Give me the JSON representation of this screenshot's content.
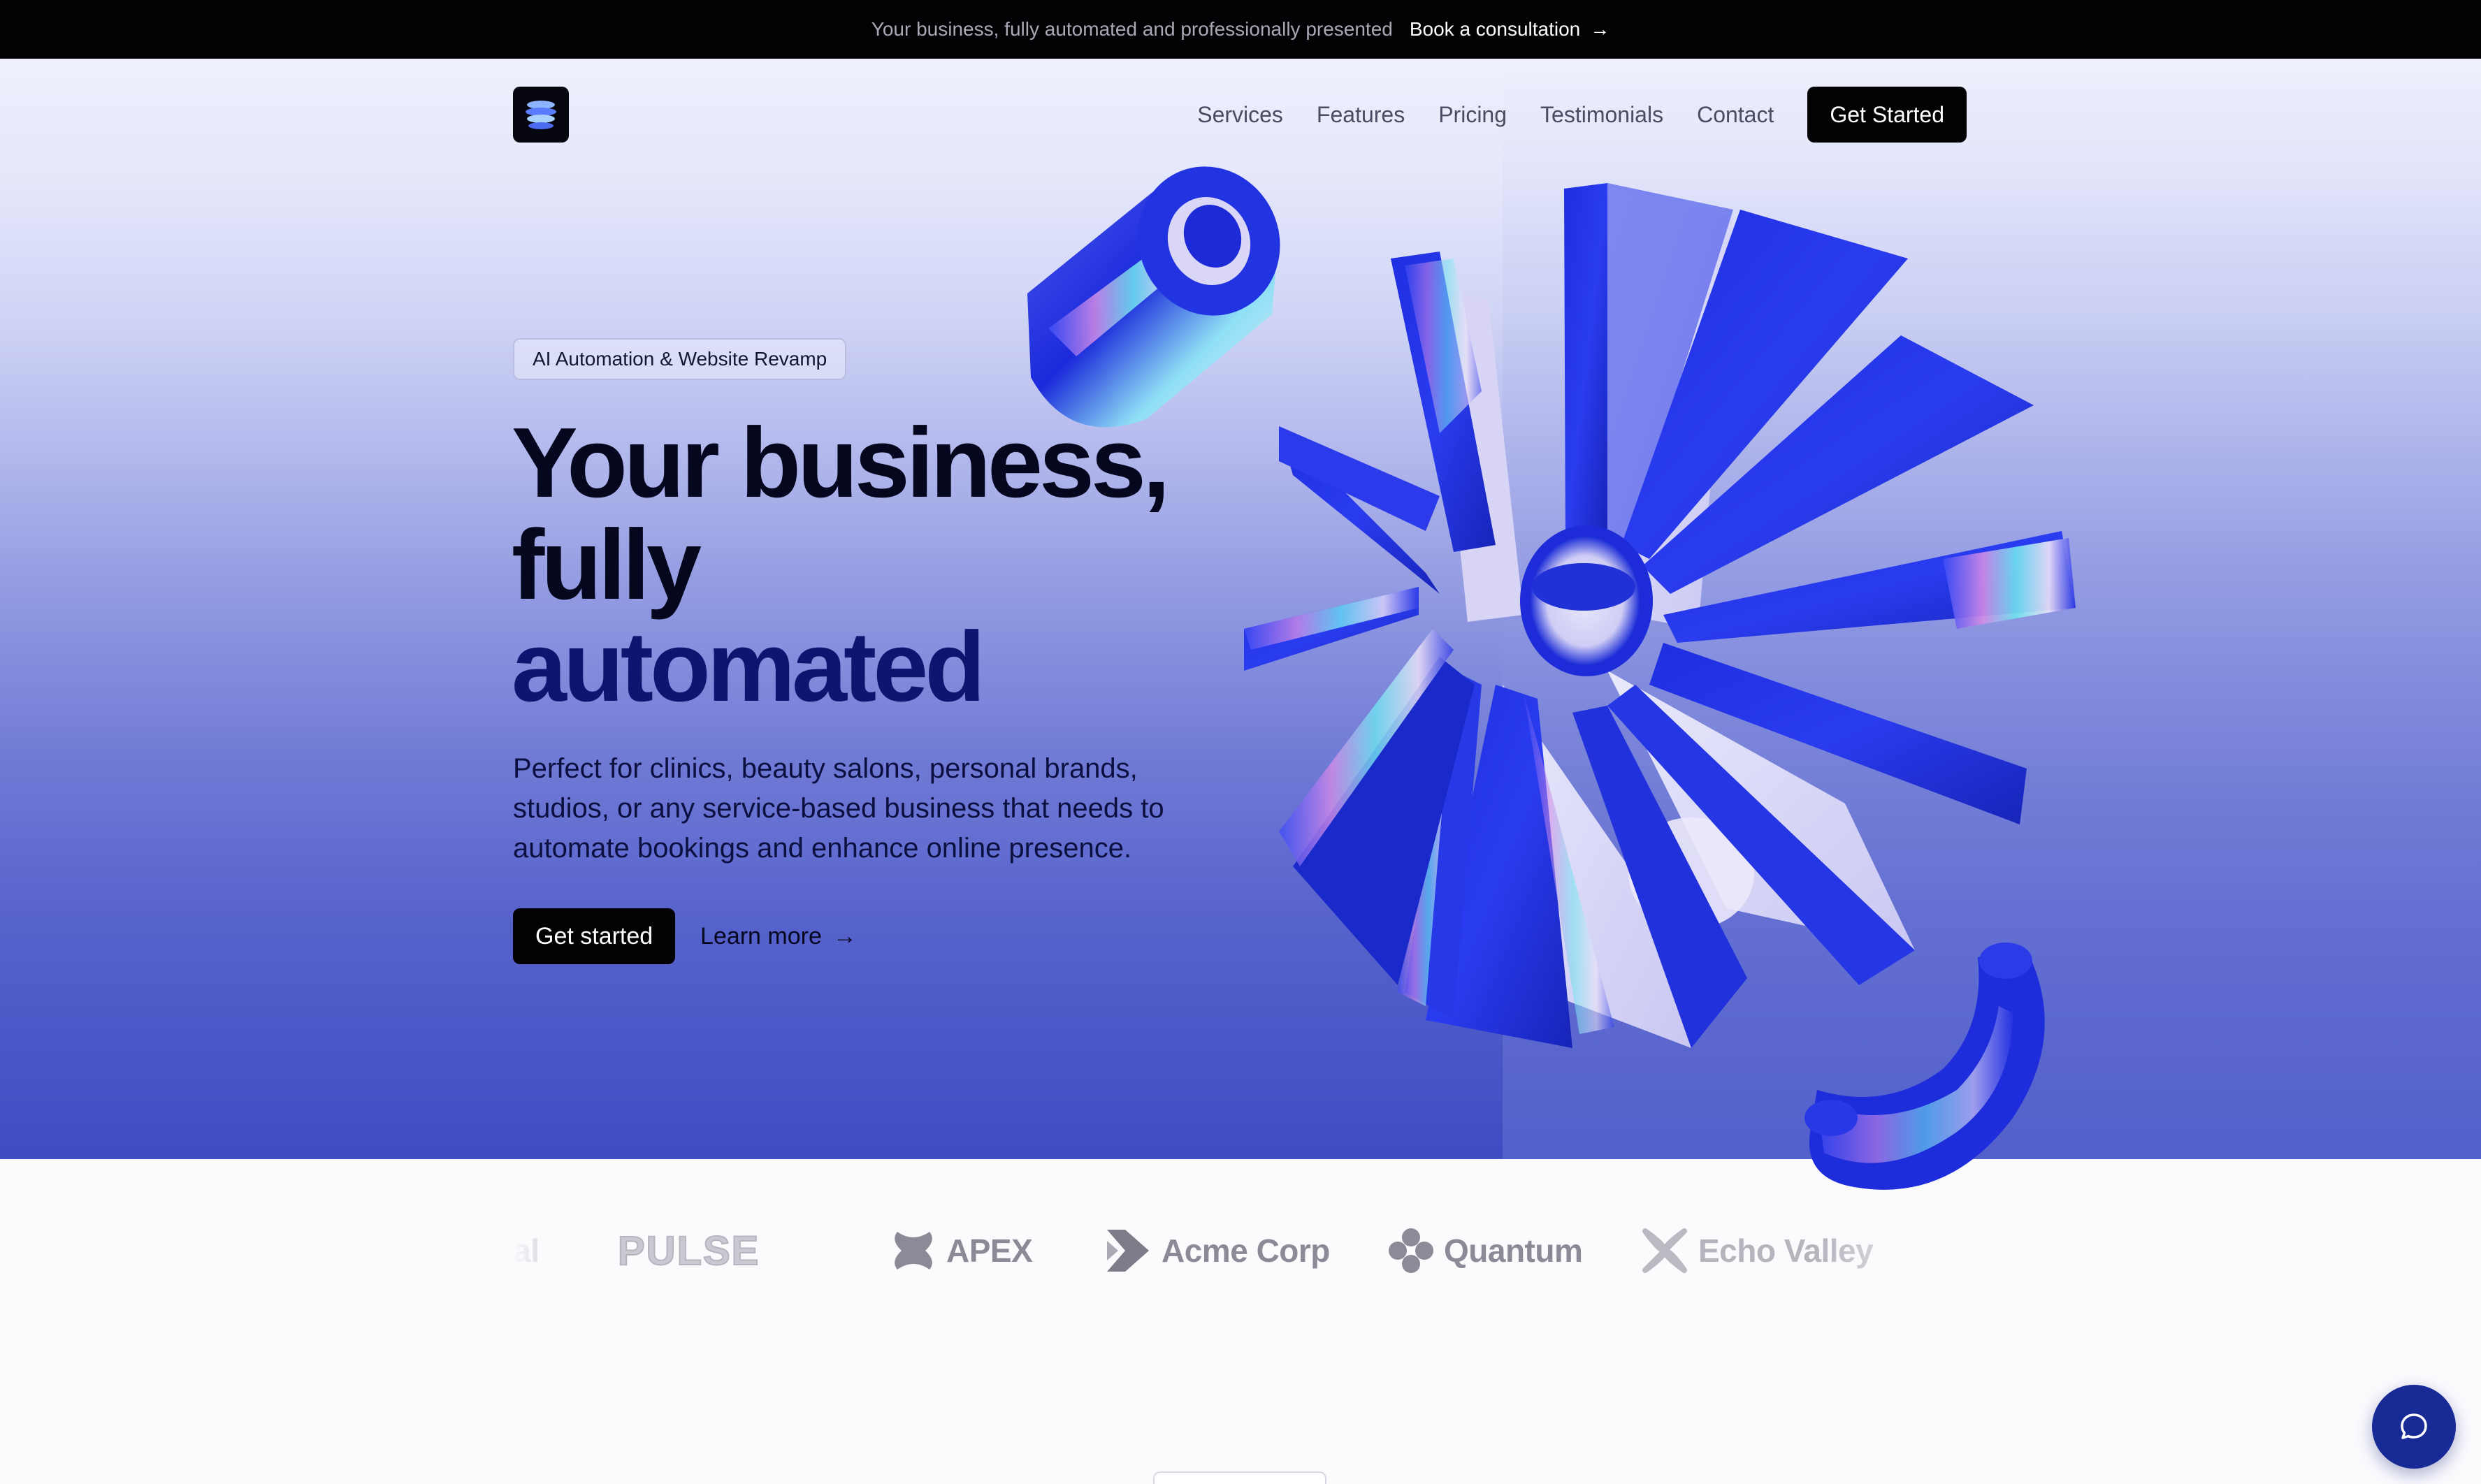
{
  "topbar": {
    "message": "Your business, fully automated and professionally presented",
    "cta_label": "Book a consultation",
    "cta_arrow": "→"
  },
  "nav": {
    "logo_icon": "layered-spiral-logo",
    "items": [
      {
        "label": "Services"
      },
      {
        "label": "Features"
      },
      {
        "label": "Pricing"
      },
      {
        "label": "Testimonials"
      },
      {
        "label": "Contact"
      }
    ],
    "cta_label": "Get Started"
  },
  "hero": {
    "badge": "AI Automation & Website Revamp",
    "headline_line1": "Your business,",
    "headline_line2": "fully",
    "headline_line3": "automated",
    "subcopy": "Perfect for clinics, beauty salons, personal brands, studios, or any service-based business that needs to automate bookings and enhance online presence.",
    "primary_button": "Get started",
    "secondary_link": "Learn more",
    "secondary_arrow": "→"
  },
  "logos": [
    {
      "name": "partial-logo",
      "label": "al",
      "icon": "none"
    },
    {
      "name": "pulse",
      "label": "PULSE",
      "icon": "none"
    },
    {
      "name": "apex",
      "label": "APEX",
      "icon": "x-blob-icon"
    },
    {
      "name": "acme-corp",
      "label": "Acme Corp",
      "icon": "chevron-stack-icon"
    },
    {
      "name": "quantum",
      "label": "Quantum",
      "icon": "clover-icon"
    },
    {
      "name": "echo-valley",
      "label": "Echo Valley",
      "icon": "x-petal-icon"
    }
  ],
  "chat": {
    "icon": "chat-bubble-icon"
  },
  "colors": {
    "brand_blue": "#1b2fd6",
    "dark": "#020205",
    "headline_accent": "#0c1570",
    "chat_bg": "#172a96"
  }
}
